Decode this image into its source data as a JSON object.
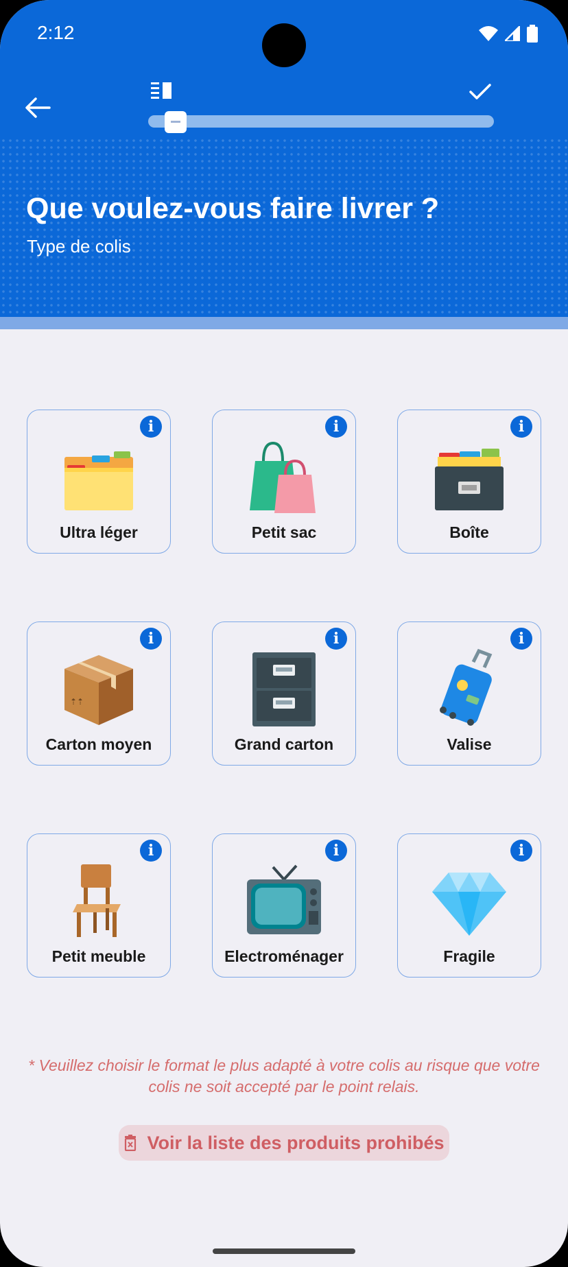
{
  "status": {
    "time": "2:12"
  },
  "header": {
    "title": "Que voulez-vous faire livrer ?",
    "subtitle": "Type de colis",
    "progress": 0.05
  },
  "cards": [
    {
      "label": "Ultra léger",
      "icon": "folder-icon"
    },
    {
      "label": "Petit sac",
      "icon": "shopping-bags-icon"
    },
    {
      "label": "Boîte",
      "icon": "card-file-box-icon"
    },
    {
      "label": "Carton moyen",
      "icon": "package-icon"
    },
    {
      "label": "Grand carton",
      "icon": "file-cabinet-icon"
    },
    {
      "label": "Valise",
      "icon": "luggage-icon"
    },
    {
      "label": "Petit meuble",
      "icon": "chair-icon"
    },
    {
      "label": "Electroménager",
      "icon": "television-icon"
    },
    {
      "label": "Fragile",
      "icon": "gem-icon"
    }
  ],
  "note": "* Veuillez choisir le format le plus adapté à votre colis au risque que votre colis ne soit accepté par le point relais.",
  "prohibited_button": "Voir la liste des produits prohibés",
  "colors": {
    "primary": "#0b68d8",
    "warning": "#d56c6c",
    "background": "#f0eff5"
  }
}
